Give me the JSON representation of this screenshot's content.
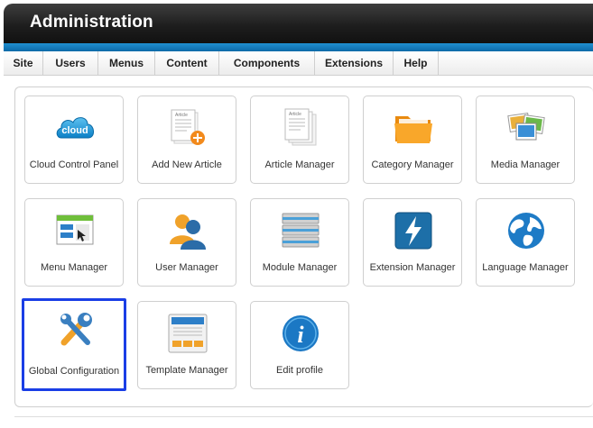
{
  "header": {
    "title": "Administration"
  },
  "menu": [
    "Site",
    "Users",
    "Menus",
    "Content",
    "Components",
    "Extensions",
    "Help"
  ],
  "tiles": [
    {
      "label": "Cloud Control Panel",
      "icon": "cloud-icon"
    },
    {
      "label": "Add New Article",
      "icon": "add-article-icon",
      "icon_text": "Article"
    },
    {
      "label": "Article Manager",
      "icon": "article-manager-icon",
      "icon_text": "Article"
    },
    {
      "label": "Category Manager",
      "icon": "folder-icon"
    },
    {
      "label": "Media Manager",
      "icon": "media-icon"
    },
    {
      "label": "Menu Manager",
      "icon": "menu-window-icon"
    },
    {
      "label": "User Manager",
      "icon": "users-icon"
    },
    {
      "label": "Module Manager",
      "icon": "modules-icon"
    },
    {
      "label": "Extension Manager",
      "icon": "lightning-icon"
    },
    {
      "label": "Language Manager",
      "icon": "globe-icon"
    },
    {
      "label": "Global Configuration",
      "icon": "tools-icon"
    },
    {
      "label": "Template Manager",
      "icon": "template-icon"
    },
    {
      "label": "Edit profile",
      "icon": "info-icon"
    }
  ],
  "cloud_text": "cloud",
  "colors": {
    "accent": "#1f8fd0",
    "selection": "#1a3ee6"
  }
}
